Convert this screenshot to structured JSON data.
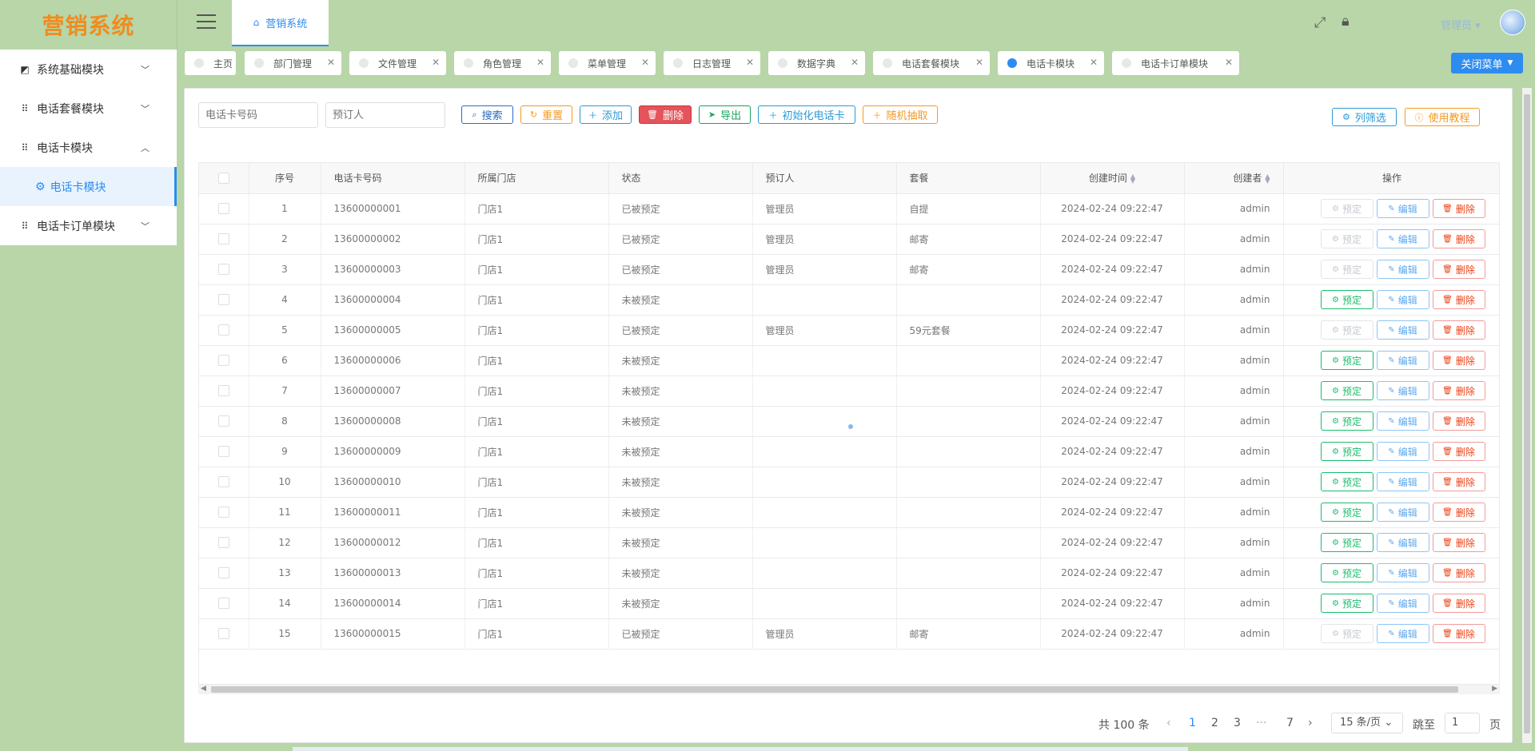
{
  "app": {
    "logo": "营销系统"
  },
  "sidebar": {
    "items": [
      {
        "label": "系统基础模块",
        "icon": "chart-icon",
        "expanded": false
      },
      {
        "label": "电话套餐模块",
        "icon": "grid-icon",
        "expanded": false
      },
      {
        "label": "电话卡模块",
        "icon": "grid-icon",
        "expanded": true
      },
      {
        "label": "电话卡订单模块",
        "icon": "grid-icon",
        "expanded": false
      }
    ],
    "sub_active": {
      "label": "电话卡模块",
      "icon": "gear-icon"
    }
  },
  "header": {
    "home_tab": "营销系统",
    "user": "管理员"
  },
  "tabs": [
    {
      "label": "主页",
      "closable": false,
      "active": false
    },
    {
      "label": "部门管理",
      "closable": true,
      "active": false
    },
    {
      "label": "文件管理",
      "closable": true,
      "active": false
    },
    {
      "label": "角色管理",
      "closable": true,
      "active": false
    },
    {
      "label": "菜单管理",
      "closable": true,
      "active": false
    },
    {
      "label": "日志管理",
      "closable": true,
      "active": false
    },
    {
      "label": "数据字典",
      "closable": true,
      "active": false
    },
    {
      "label": "电话套餐模块",
      "closable": true,
      "active": false
    },
    {
      "label": "电话卡模块",
      "closable": true,
      "active": true
    },
    {
      "label": "电话卡订单模块",
      "closable": true,
      "active": false
    }
  ],
  "close_menu_label": "关闭菜单",
  "toolbar": {
    "phone_placeholder": "电话卡号码",
    "reserver_placeholder": "预订人",
    "search": "搜索",
    "reset": "重置",
    "add": "添加",
    "delete": "删除",
    "export": "导出",
    "init": "初始化电话卡",
    "random": "随机抽取",
    "column_filter": "列筛选",
    "tutorial": "使用教程"
  },
  "table": {
    "columns": [
      "序号",
      "电话卡号码",
      "所属门店",
      "状态",
      "预订人",
      "套餐",
      "创建时间",
      "创建者",
      "操作"
    ],
    "op_labels": {
      "reserve": "预定",
      "edit": "编辑",
      "delete": "删除"
    },
    "rows": [
      {
        "no": "1",
        "phone": "13600000001",
        "store": "门店1",
        "status": "已被预定",
        "reserver": "管理员",
        "plan": "自提",
        "created": "2024-02-24 09:22:47",
        "creator": "admin",
        "reserved": true
      },
      {
        "no": "2",
        "phone": "13600000002",
        "store": "门店1",
        "status": "已被预定",
        "reserver": "管理员",
        "plan": "邮寄",
        "created": "2024-02-24 09:22:47",
        "creator": "admin",
        "reserved": true
      },
      {
        "no": "3",
        "phone": "13600000003",
        "store": "门店1",
        "status": "已被预定",
        "reserver": "管理员",
        "plan": "邮寄",
        "created": "2024-02-24 09:22:47",
        "creator": "admin",
        "reserved": true
      },
      {
        "no": "4",
        "phone": "13600000004",
        "store": "门店1",
        "status": "未被预定",
        "reserver": "",
        "plan": "",
        "created": "2024-02-24 09:22:47",
        "creator": "admin",
        "reserved": false
      },
      {
        "no": "5",
        "phone": "13600000005",
        "store": "门店1",
        "status": "已被预定",
        "reserver": "管理员",
        "plan": "59元套餐",
        "created": "2024-02-24 09:22:47",
        "creator": "admin",
        "reserved": true
      },
      {
        "no": "6",
        "phone": "13600000006",
        "store": "门店1",
        "status": "未被预定",
        "reserver": "",
        "plan": "",
        "created": "2024-02-24 09:22:47",
        "creator": "admin",
        "reserved": false
      },
      {
        "no": "7",
        "phone": "13600000007",
        "store": "门店1",
        "status": "未被预定",
        "reserver": "",
        "plan": "",
        "created": "2024-02-24 09:22:47",
        "creator": "admin",
        "reserved": false
      },
      {
        "no": "8",
        "phone": "13600000008",
        "store": "门店1",
        "status": "未被预定",
        "reserver": "",
        "plan": "",
        "created": "2024-02-24 09:22:47",
        "creator": "admin",
        "reserved": false
      },
      {
        "no": "9",
        "phone": "13600000009",
        "store": "门店1",
        "status": "未被预定",
        "reserver": "",
        "plan": "",
        "created": "2024-02-24 09:22:47",
        "creator": "admin",
        "reserved": false
      },
      {
        "no": "10",
        "phone": "13600000010",
        "store": "门店1",
        "status": "未被预定",
        "reserver": "",
        "plan": "",
        "created": "2024-02-24 09:22:47",
        "creator": "admin",
        "reserved": false
      },
      {
        "no": "11",
        "phone": "13600000011",
        "store": "门店1",
        "status": "未被预定",
        "reserver": "",
        "plan": "",
        "created": "2024-02-24 09:22:47",
        "creator": "admin",
        "reserved": false
      },
      {
        "no": "12",
        "phone": "13600000012",
        "store": "门店1",
        "status": "未被预定",
        "reserver": "",
        "plan": "",
        "created": "2024-02-24 09:22:47",
        "creator": "admin",
        "reserved": false
      },
      {
        "no": "13",
        "phone": "13600000013",
        "store": "门店1",
        "status": "未被预定",
        "reserver": "",
        "plan": "",
        "created": "2024-02-24 09:22:47",
        "creator": "admin",
        "reserved": false
      },
      {
        "no": "14",
        "phone": "13600000014",
        "store": "门店1",
        "status": "未被预定",
        "reserver": "",
        "plan": "",
        "created": "2024-02-24 09:22:47",
        "creator": "admin",
        "reserved": false
      },
      {
        "no": "15",
        "phone": "13600000015",
        "store": "门店1",
        "status": "已被预定",
        "reserver": "管理员",
        "plan": "邮寄",
        "created": "2024-02-24 09:22:47",
        "creator": "admin",
        "reserved": true
      }
    ]
  },
  "pagination": {
    "total_text": "共 100 条",
    "pages": [
      "1",
      "2",
      "3",
      "···",
      "7"
    ],
    "current": "1",
    "page_size": "15 条/页",
    "jump_label": "跳至",
    "jump_value": "1",
    "page_suffix": "页"
  },
  "colors": {
    "accent": "#2d8cf0",
    "sidebar_bg": "#b8d6a8",
    "logo": "#f08c1e"
  }
}
